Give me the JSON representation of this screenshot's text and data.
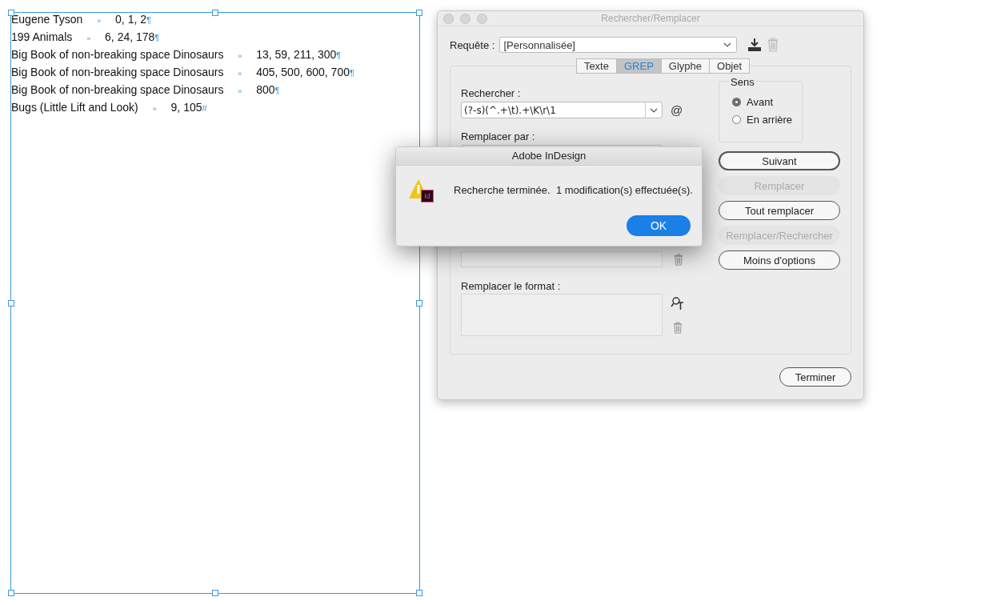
{
  "document": {
    "lines": [
      {
        "title": "Eugene Tyson",
        "tab": "»",
        "pages": "0, 1, 2",
        "end": "¶"
      },
      {
        "title": "199 Animals",
        "tab": "»",
        "pages": "6, 24, 178",
        "end": "¶"
      },
      {
        "title": "Big Book of non-breaking space Dinosaurs",
        "tab": "»",
        "pages": "13, 59, 211, 300",
        "end": "¶"
      },
      {
        "title": "Big Book of non-breaking space Dinosaurs",
        "tab": "»",
        "pages": "405, 500, 600, 700",
        "end": "¶"
      },
      {
        "title": "Big Book of non-breaking space Dinosaurs",
        "tab": "»",
        "pages": "800",
        "end": "¶"
      },
      {
        "title": "Bugs (Little Lift and Look)",
        "tab": "»",
        "pages": "9, 105",
        "end": "#"
      }
    ]
  },
  "find_replace": {
    "title": "Rechercher/Remplacer",
    "query_label": "Requête :",
    "query": "[Personnalisée]",
    "tabs": [
      {
        "label": "Texte",
        "selected": false
      },
      {
        "label": "GREP",
        "selected": true
      },
      {
        "label": "Glyphe",
        "selected": false
      },
      {
        "label": "Objet",
        "selected": false
      }
    ],
    "find_label": "Rechercher :",
    "find_value": "(?-s)(^.+\\t).+\\K\\r\\1",
    "special_char_button": "@",
    "replace_label": "Remplacer par :",
    "replace_format_label": "Remplacer le format :",
    "direction": {
      "title": "Sens",
      "options": [
        {
          "label": "Avant",
          "selected": true
        },
        {
          "label": "En arrière",
          "selected": false
        }
      ]
    },
    "buttons": [
      {
        "label": "Suivant",
        "disabled": false
      },
      {
        "label": "Remplacer",
        "disabled": true
      },
      {
        "label": "Tout remplacer",
        "disabled": false
      },
      {
        "label": "Remplacer/Rechercher",
        "disabled": true
      },
      {
        "label": "Moins d'options",
        "disabled": false
      }
    ],
    "done_button": "Terminer"
  },
  "alert": {
    "title": "Adobe InDesign",
    "app_badge": "Id",
    "message": "Recherche terminée.  1 modification(s) effectuée(s).",
    "button": "OK"
  }
}
